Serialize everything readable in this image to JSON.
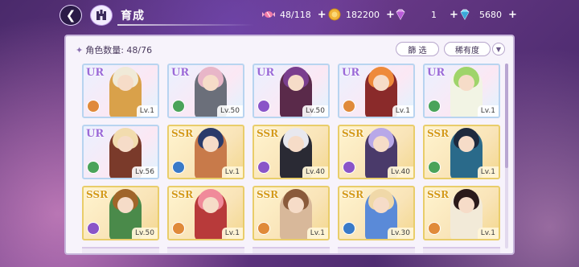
{
  "header": {
    "title": "育成",
    "resources": [
      {
        "icon": "candy-icon",
        "value": "48/118"
      },
      {
        "icon": "coin-icon",
        "value": "182200"
      },
      {
        "icon": "pink-gem-icon",
        "value": "1"
      },
      {
        "icon": "blue-gem-icon",
        "value": "5680"
      }
    ],
    "plus": "+"
  },
  "panel": {
    "count_label": "角色数量: 48/76",
    "filter_label": "篩 选",
    "rarity_label": "稀有度",
    "sort_icon": "chevron-down-icon"
  },
  "characters": [
    {
      "rank": "UR",
      "level": "Lv.1",
      "elem_color": "#e08a3a",
      "hair": "#f0ead8",
      "outfit": "#d9a14a"
    },
    {
      "rank": "UR",
      "level": "Lv.50",
      "elem_color": "#4aa35a",
      "hair": "#e8b6c8",
      "outfit": "#6b6f7a"
    },
    {
      "rank": "UR",
      "level": "Lv.50",
      "elem_color": "#8a55c8",
      "hair": "#7a3e8e",
      "outfit": "#5a2a4a"
    },
    {
      "rank": "UR",
      "level": "Lv.1",
      "elem_color": "#e08a3a",
      "hair": "#ee8a3a",
      "outfit": "#8a2a2a"
    },
    {
      "rank": "UR",
      "level": "Lv.1",
      "elem_color": "#4aa35a",
      "hair": "#9fd46a",
      "outfit": "#f2f4e4"
    },
    {
      "rank": "UR",
      "level": "Lv.56",
      "elem_color": "#4aa35a",
      "hair": "#f2dcae",
      "outfit": "#7a3a2a"
    },
    {
      "rank": "SSR",
      "level": "Lv.1",
      "elem_color": "#3a7ac8",
      "hair": "#2a3a6a",
      "outfit": "#c87a4a"
    },
    {
      "rank": "SSR",
      "level": "Lv.40",
      "elem_color": "#8a55c8",
      "hair": "#e8e8ee",
      "outfit": "#2a2a34"
    },
    {
      "rank": "SSR",
      "level": "Lv.40",
      "elem_color": "#8a55c8",
      "hair": "#b8a8e8",
      "outfit": "#4a3a6a"
    },
    {
      "rank": "SSR",
      "level": "Lv.1",
      "elem_color": "#4aa35a",
      "hair": "#1e2a3e",
      "outfit": "#2a6a8a"
    },
    {
      "rank": "SSR",
      "level": "Lv.50",
      "elem_color": "#8a55c8",
      "hair": "#a0652a",
      "outfit": "#4a8a4a"
    },
    {
      "rank": "SSR",
      "level": "Lv.1",
      "elem_color": "#e08a3a",
      "hair": "#f08a9a",
      "outfit": "#b83a3a"
    },
    {
      "rank": "SSR",
      "level": "Lv.1",
      "elem_color": "#e08a3a",
      "hair": "#8a5a3a",
      "outfit": "#d8b89a"
    },
    {
      "rank": "SSR",
      "level": "Lv.30",
      "elem_color": "#3a7ac8",
      "hair": "#f0d8a8",
      "outfit": "#5a8ad8"
    },
    {
      "rank": "SSR",
      "level": "Lv.1",
      "elem_color": "#e08a3a",
      "hair": "#2a1a1a",
      "outfit": "#f2ead8"
    }
  ],
  "colors": {
    "panel_bg": "#f7f3fb",
    "ur_border": "#b8d4f0",
    "ssr_border": "#e9cd6a"
  }
}
